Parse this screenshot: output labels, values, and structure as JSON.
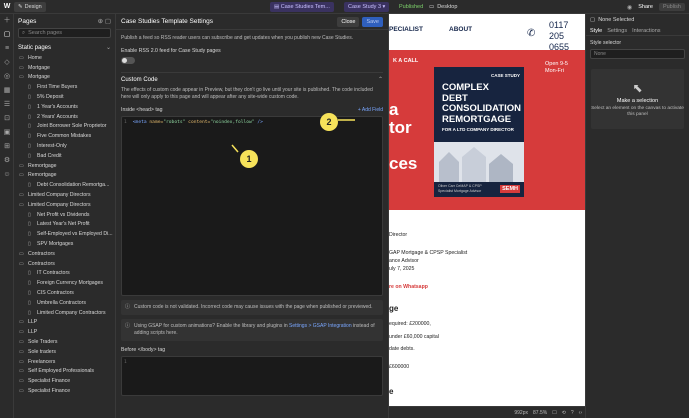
{
  "topbar": {
    "logo": "W",
    "design_label": "Design",
    "page_label_1": "Case Studies Tem...",
    "page_label_2": "Case Study 3",
    "published_label": "Published",
    "desktop_label": "Desktop",
    "share_label": "Share",
    "publish_label": "Publish"
  },
  "pages_panel": {
    "title": "Pages",
    "search_placeholder": "Search pages",
    "static_title": "Static pages",
    "items": [
      {
        "label": "Home",
        "indent": 1
      },
      {
        "label": "Mortgage",
        "indent": 1
      },
      {
        "label": "Mortgage",
        "indent": 1
      },
      {
        "label": "First Time Buyers",
        "indent": 2
      },
      {
        "label": "5% Deposit",
        "indent": 2
      },
      {
        "label": "1 Year's Accounts",
        "indent": 2
      },
      {
        "label": "2 Years' Accounts",
        "indent": 2
      },
      {
        "label": "Joint Borrower Sole Proprietor",
        "indent": 2
      },
      {
        "label": "Five Common Mistakes",
        "indent": 2
      },
      {
        "label": "Interest-Only",
        "indent": 2
      },
      {
        "label": "Bad Credit",
        "indent": 2
      },
      {
        "label": "Remortgage",
        "indent": 1
      },
      {
        "label": "Remortgage",
        "indent": 1
      },
      {
        "label": "Debt Consolidation Remortga...",
        "indent": 2
      },
      {
        "label": "Limited Company Directors",
        "indent": 1
      },
      {
        "label": "Limited Company Directors",
        "indent": 1
      },
      {
        "label": "Net Profit vs Dividends",
        "indent": 2
      },
      {
        "label": "Latest Year's Net Profit",
        "indent": 2
      },
      {
        "label": "Self-Employed vs Employed Di...",
        "indent": 2
      },
      {
        "label": "SPV Mortgages",
        "indent": 2
      },
      {
        "label": "Contractors",
        "indent": 1
      },
      {
        "label": "Contractors",
        "indent": 1
      },
      {
        "label": "IT Contractors",
        "indent": 2
      },
      {
        "label": "Foreign Currency Mortgages",
        "indent": 2
      },
      {
        "label": "CIS Contractors",
        "indent": 2
      },
      {
        "label": "Umbrella Contractors",
        "indent": 2
      },
      {
        "label": "Limited Company Contractors",
        "indent": 2
      },
      {
        "label": "LLP",
        "indent": 1
      },
      {
        "label": "LLP",
        "indent": 1
      },
      {
        "label": "Sole Traders",
        "indent": 1
      },
      {
        "label": "Sole traders",
        "indent": 1
      },
      {
        "label": "Freelancers",
        "indent": 1
      },
      {
        "label": "Self Employed Professionals",
        "indent": 1
      },
      {
        "label": "Specialist Finance",
        "indent": 1
      },
      {
        "label": "Specialist Finance",
        "indent": 1
      }
    ]
  },
  "modal": {
    "title": "Case Studies Template Settings",
    "close_label": "Close",
    "save_label": "Save",
    "rss_desc": "Publish a feed so RSS reader users can subscribe and get updates when you publish new Case Studies.",
    "rss_label": "Enable RSS 2.0 feed for Case Study pages",
    "custom_code_title": "Custom Code",
    "custom_code_desc": "The effects of custom code appear in Preview, but they don't go live until your site is published. The code included here will only apply to this page and will appear after any site-wide custom code.",
    "head_label": "Inside <head> tag",
    "add_field": "+ Add Field",
    "head_code": {
      "line": "1",
      "tag_open": "<meta",
      "attr1": "name=",
      "val1": "\"robots\"",
      "attr2": "content=",
      "val2": "\"noindex,follow\"",
      "tag_close": "/>"
    },
    "warn_text": "Custom code is not validated. Incorrect code may cause issues with the page when published or previewed.",
    "gsap_text": "Using GSAP for custom animations? Enable the library and plugins in ",
    "gsap_link": "Settings > GSAP Integration",
    "gsap_text2": " instead of adding scripts here.",
    "body_label": "Before </body> tag",
    "body_line": "1"
  },
  "annotations": {
    "a1": "1",
    "a2": "2"
  },
  "canvas": {
    "nav_a": "PECIALIST",
    "nav_b": "ABOUT",
    "phone": "0117\n205\n0655",
    "hours": "Open 9-5\nMon-Fri",
    "call": "K A CALL",
    "hero_a": "a",
    "hero_b": "tor",
    "hero_c": "ces",
    "book_tag": "CASE STUDY",
    "book_title": "COMPLEX\nDEBT\nCONSOLIDATION\nREMORTGAGE",
    "book_sub": "FOR A LTD COMPANY DIRECTOR",
    "book_author": "Oliver Carr CeMAP & CPSP Specialist Mortgage Advisor",
    "book_logo": "SEMH",
    "t1": "Director",
    "t2": "GAP Mortgage & CPSP Specialist",
    "t3": "ance Advisor",
    "t4": "uly 7, 2025",
    "t5": "re on Whatsapp",
    "t6": "ge",
    "t7": "equired: £200000,",
    "t8": "under £60,000 capital",
    "t9": "date debts.",
    "t10": "£600000",
    "t11": "e"
  },
  "status": {
    "size": "992px",
    "zoom": "87.5%"
  },
  "right_panel": {
    "none_selected": "None Selected",
    "tabs": [
      "Style",
      "Settings",
      "Interactions"
    ],
    "selector_label": "Style selector",
    "selector_value": "None",
    "ms_title": "Make a selection",
    "ms_desc": "Select an element on the canvas to activate this panel"
  },
  "colors": {
    "accent": "#2f5fbd",
    "hero_red": "#d63b3b",
    "navy": "#17243f",
    "annot": "#f6e25a"
  }
}
